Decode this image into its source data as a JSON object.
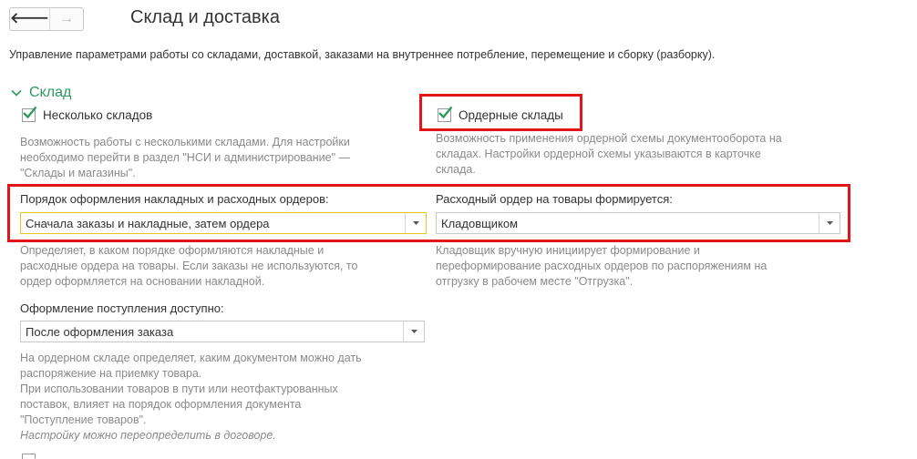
{
  "header": {
    "back_icon": "arrow-left-icon",
    "forward_icon": "arrow-right-icon",
    "back_glyph": "🡐",
    "forward_glyph": "→",
    "title": "Склад и доставка"
  },
  "description": "Управление параметрами работы со складами, доставкой, заказами на внутреннее потребление, перемещение и сборку (разборку).",
  "section": {
    "title": "Склад",
    "collapse_icon": "chevron-down-icon"
  },
  "multiple_warehouses": {
    "label": "Несколько складов",
    "checked": true,
    "hint_lines": [
      "Возможность работы с несколькими складами. Для настройки",
      "необходимо перейти в раздел \"НСИ и администрирование\" —",
      "\"Склады и магазины\"."
    ]
  },
  "order_warehouses": {
    "label": "Ордерные склады",
    "checked": true,
    "hint_lines": [
      "Возможность применения ордерной схемы документооборота на",
      "складах. Настройки ордерной схемы указываются в карточке",
      "склада."
    ]
  },
  "documents_order": {
    "label": "Порядок оформления накладных и расходных ордеров:",
    "value": "Сначала заказы и накладные, затем ордера",
    "hint_lines": [
      "Определяет, в каком порядке оформляются накладные и",
      "расходные ордера на товары. Если заказы не используются, то",
      "ордер оформляется на основании накладной."
    ]
  },
  "expense_order": {
    "label": "Расходный ордер на товары формируется:",
    "value": "Кладовщиком",
    "hint_lines": [
      "Кладовщик вручную инициирует формирование и",
      "переформирование расходных ордеров по распоряжениям на",
      "отгрузку в рабочем месте \"Отгрузка\"."
    ]
  },
  "receipt": {
    "label": "Оформление поступления доступно:",
    "value": "После оформления заказа",
    "hint_lines": [
      "На ордерном складе определяет, каким документом можно дать",
      "распоряжение на приемку товара.",
      "При использовании товаров в пути или неотфактурованных",
      "поставок, влияет на порядок оформления документа",
      "\"Поступление товаров\"."
    ],
    "note": "Настройку можно переопределить в договоре."
  },
  "colors": {
    "accent_green": "#2e9a5e",
    "highlight_red": "#e3141a",
    "focus_yellow": "#e6c51e",
    "hint_gray": "#8a8a8a"
  }
}
